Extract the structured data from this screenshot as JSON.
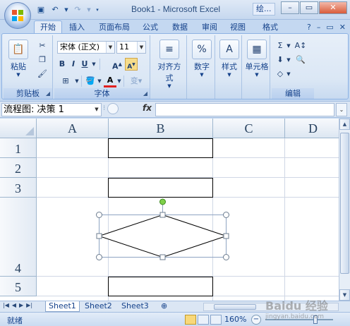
{
  "window": {
    "title": "Book1 - Microsoft Excel",
    "secondary_title": "绘..."
  },
  "tabs": [
    "开始",
    "插入",
    "页面布局",
    "公式",
    "数据",
    "审阅",
    "视图",
    "格式"
  ],
  "active_tab": "开始",
  "ribbon": {
    "clipboard": {
      "paste_label": "粘贴",
      "group_label": "剪贴板"
    },
    "font": {
      "font_name": "宋体 (正文)",
      "font_size": "11",
      "bold": "B",
      "italic": "I",
      "underline": "U",
      "group_label": "字体"
    },
    "alignment": {
      "label": "对齐方式"
    },
    "number": {
      "label": "数字"
    },
    "styles": {
      "label": "样式"
    },
    "cells": {
      "label": "单元格"
    },
    "editing": {
      "group_label": "编辑"
    }
  },
  "formula_bar": {
    "name_box": "流程图: 决策 1",
    "fx_label": "fx",
    "value": ""
  },
  "columns": [
    "A",
    "B",
    "C",
    "D"
  ],
  "rows": [
    "1",
    "2",
    "3",
    "4",
    "5"
  ],
  "sheets": [
    "Sheet1",
    "Sheet2",
    "Sheet3"
  ],
  "active_sheet": "Sheet1",
  "status": {
    "ready": "就绪",
    "zoom": "160%"
  },
  "watermark": {
    "logo": "Baidu 经验",
    "url": "jingyan.baidu.com"
  },
  "colors": {
    "accent": "#15428b",
    "handle_green": "#7fd04a",
    "ribbon_bg": "#dbe7f5"
  }
}
